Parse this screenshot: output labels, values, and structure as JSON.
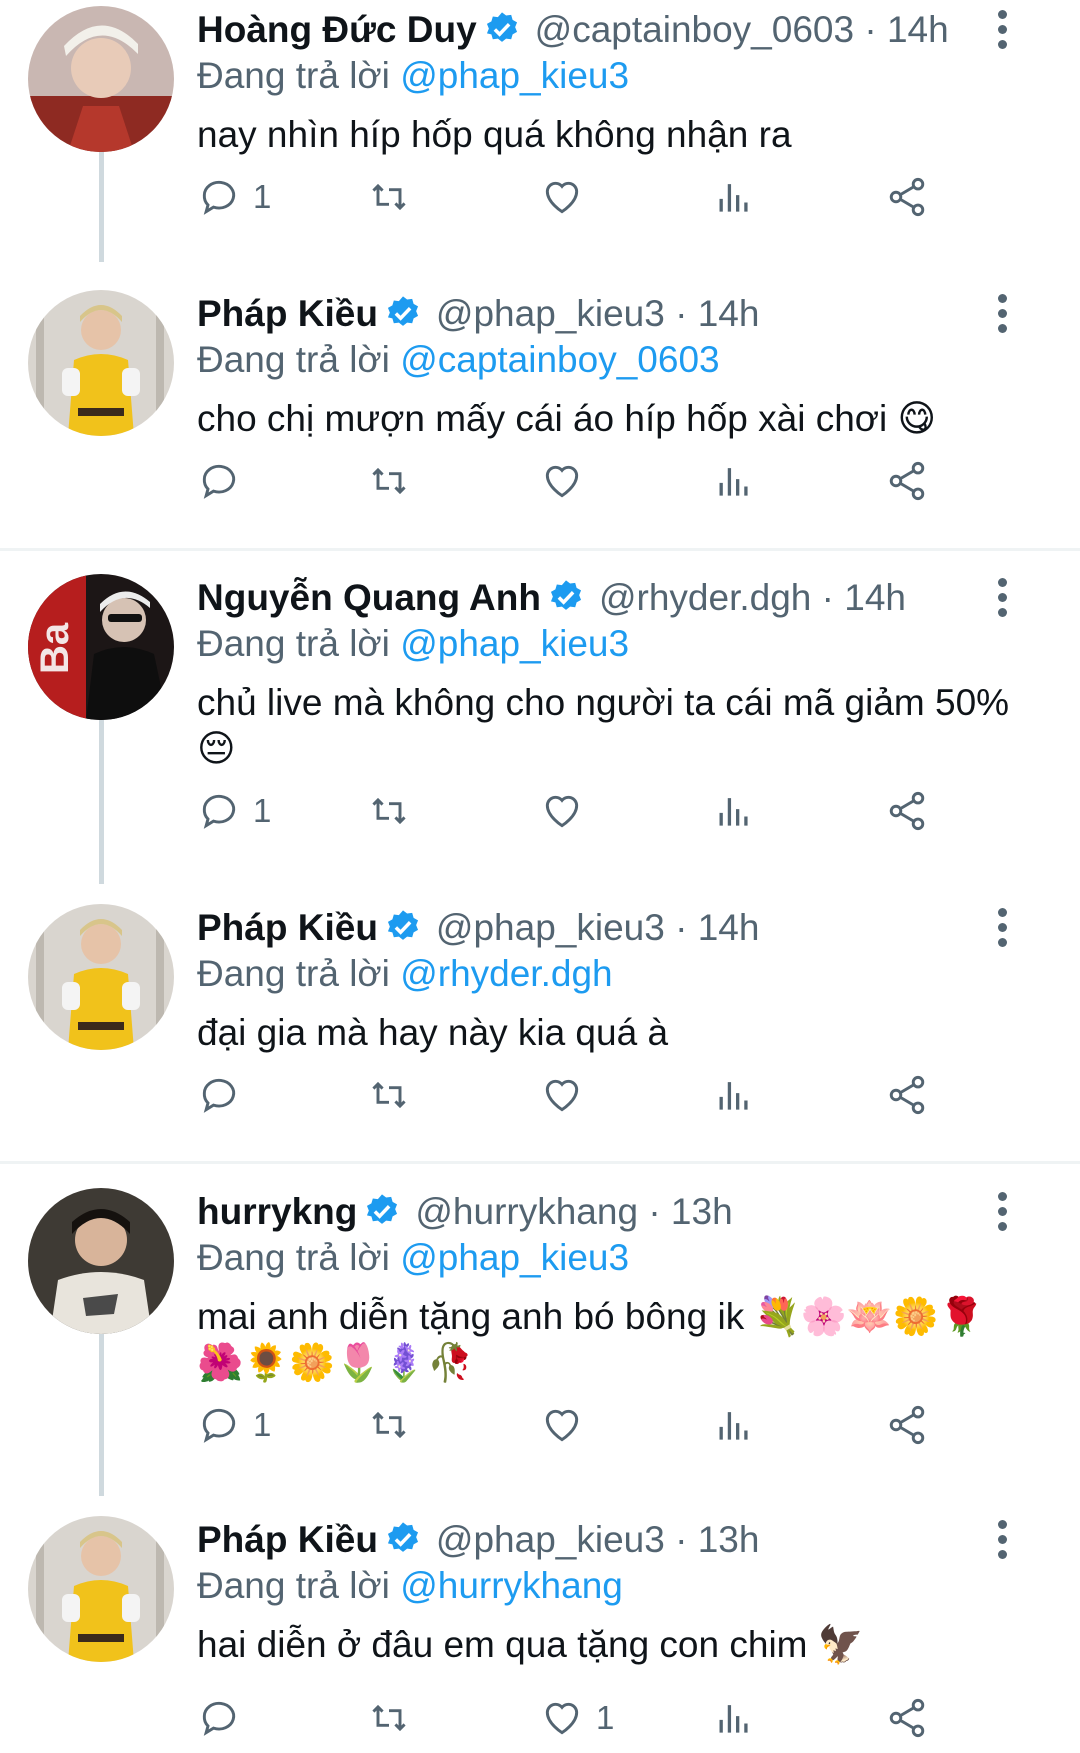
{
  "replying_prefix": "Đang trả lời",
  "colors": {
    "verified": "#1d9bf0",
    "link": "#1d9bf0",
    "muted": "#536471",
    "thread_line": "#cfd9de"
  },
  "tweets": [
    {
      "name": "Hoàng Đức Duy",
      "handle": "@captainboy_0603",
      "time": "· 14h",
      "reply_to": "@phap_kieu3",
      "text": "nay nhìn híp hốp quá không nhận ra",
      "reply_count": "1",
      "like_count": "",
      "avatar": "hoang-duc-duy-avatar"
    },
    {
      "name": "Pháp Kiều",
      "handle": "@phap_kieu3",
      "time": "· 14h",
      "reply_to": "@captainboy_0603",
      "text": "cho chị mượn mấy cái áo híp hốp xài chơi 😋",
      "reply_count": "",
      "like_count": "",
      "avatar": "phap-kieu-avatar"
    },
    {
      "name": "Nguyễn Quang Anh",
      "handle": "@rhyder.dgh",
      "time": "· 14h",
      "reply_to": "@phap_kieu3",
      "text": "chủ live mà không cho người ta cái mã giảm 50% 😔",
      "reply_count": "1",
      "like_count": "",
      "avatar": "nguyen-quang-anh-avatar"
    },
    {
      "name": "Pháp Kiều",
      "handle": "@phap_kieu3",
      "time": "· 14h",
      "reply_to": "@rhyder.dgh",
      "text": "đại gia mà hay này kia quá à",
      "reply_count": "",
      "like_count": "",
      "avatar": "phap-kieu-avatar"
    },
    {
      "name": "hurrykng",
      "handle": "@hurrykhang",
      "time": "· 13h",
      "reply_to": "@phap_kieu3",
      "text": "mai anh diễn tặng anh bó bông ik 💐🌸🪷🌼🌹🌺🌻🌼🌷🪻🥀",
      "reply_count": "1",
      "like_count": "",
      "avatar": "hurrykng-avatar"
    },
    {
      "name": "Pháp Kiều",
      "handle": "@phap_kieu3",
      "time": "· 13h",
      "reply_to": "@hurrykhang",
      "text": "hai diễn ở đâu em qua tặng con chim 🦅",
      "reply_count": "",
      "like_count": "1",
      "avatar": "phap-kieu-avatar"
    }
  ]
}
